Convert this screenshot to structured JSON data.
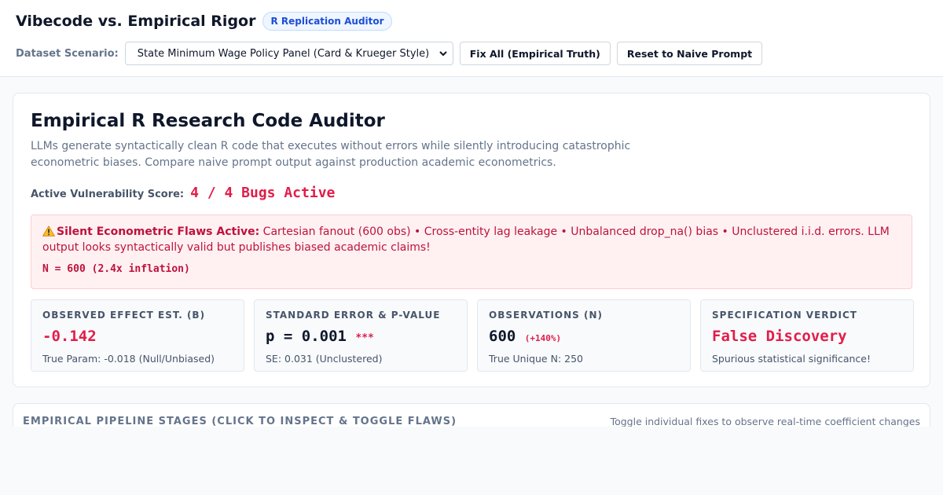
{
  "header": {
    "title": "Vibecode vs. Empirical Rigor",
    "badge": "R Replication Auditor",
    "dataset_label": "Dataset Scenario:",
    "dataset_selected": "State Minimum Wage Policy Panel (Card & Krueger Style)",
    "fix_all_label": "Fix All (Empirical Truth)",
    "reset_label": "Reset to Naive Prompt"
  },
  "auditor": {
    "title": "Empirical R Research Code Auditor",
    "description": "LLMs generate syntactically clean R code that executes without errors while silently introducing catastrophic econometric biases. Compare naive prompt output against production academic econometrics.",
    "score_label": "Active Vulnerability Score:",
    "score_value": "4 / 4 Bugs Active"
  },
  "alert": {
    "heading": "Silent Econometric Flaws Active:",
    "body": " Cartesian fanout (600 obs) • Cross-entity lag leakage • Unbalanced drop_na() bias • Unclustered i.i.d. errors. LLM output looks syntactically valid but publishes biased academic claims!",
    "n_note": "N = 600 (2.4x inflation)",
    "icon": "warning-icon"
  },
  "metrics": [
    {
      "label": "OBSERVED EFFECT EST. (B)",
      "value": "-0.142",
      "extra": "",
      "sub": "True Param: -0.018 (Null/Unbiased)"
    },
    {
      "label": "STANDARD ERROR & P-VALUE",
      "value": "p = 0.001",
      "extra": "***",
      "sub": "SE: 0.031 (Unclustered)"
    },
    {
      "label": "OBSERVATIONS (N)",
      "value": "600",
      "extra": "(+140%)",
      "sub": "True Unique N: 250"
    },
    {
      "label": "SPECIFICATION VERDICT",
      "value": "False Discovery",
      "extra": "",
      "sub": "Spurious statistical significance!"
    }
  ],
  "stages": {
    "title": "EMPIRICAL PIPELINE STAGES (CLICK TO INSPECT & TOGGLE FLAWS)",
    "hint": "Toggle individual fixes to observe real-time coefficient changes"
  },
  "colors": {
    "accent_red": "#e11d48",
    "badge_blue": "#1d4ed8",
    "alert_bg": "#fff1f2"
  }
}
